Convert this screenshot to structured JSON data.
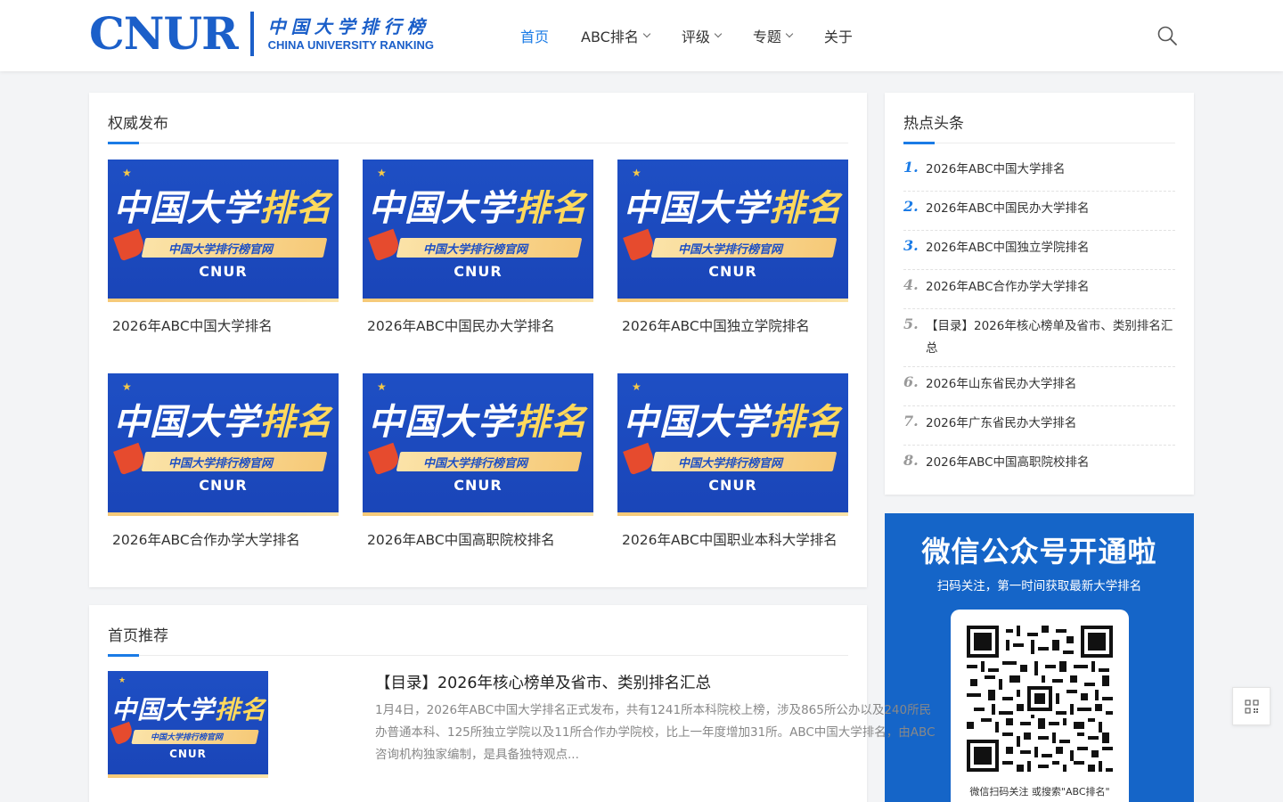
{
  "header": {
    "logo": {
      "text": "CNUR",
      "cn": "中国大学排行榜",
      "en": "CHINA UNIVERSITY RANKING"
    },
    "nav": [
      {
        "label": "首页",
        "active": true,
        "dropdown": false
      },
      {
        "label": "ABC排名",
        "active": false,
        "dropdown": true
      },
      {
        "label": "评级",
        "active": false,
        "dropdown": true
      },
      {
        "label": "专题",
        "active": false,
        "dropdown": true
      },
      {
        "label": "关于",
        "active": false,
        "dropdown": false
      }
    ]
  },
  "banner": {
    "title_a": "中国大学",
    "title_b": "排名",
    "ribbon": "中国大学排行榜官网",
    "brand": "CNUR"
  },
  "authority": {
    "title": "权威发布",
    "items": [
      {
        "caption": "2026年ABC中国大学排名"
      },
      {
        "caption": "2026年ABC中国民办大学排名"
      },
      {
        "caption": "2026年ABC中国独立学院排名"
      },
      {
        "caption": "2026年ABC合作办学大学排名"
      },
      {
        "caption": "2026年ABC中国高职院校排名"
      },
      {
        "caption": "2026年ABC中国职业本科大学排名"
      }
    ]
  },
  "hot": {
    "title": "热点头条",
    "items": [
      {
        "num": "1.",
        "text": "2026年ABC中国大学排名"
      },
      {
        "num": "2.",
        "text": "2026年ABC中国民办大学排名"
      },
      {
        "num": "3.",
        "text": "2026年ABC中国独立学院排名"
      },
      {
        "num": "4.",
        "text": "2026年ABC合作办学大学排名"
      },
      {
        "num": "5.",
        "text": "【目录】2026年核心榜单及省市、类别排名汇总"
      },
      {
        "num": "6.",
        "text": "2026年山东省民办大学排名"
      },
      {
        "num": "7.",
        "text": "2026年广东省民办大学排名"
      },
      {
        "num": "8.",
        "text": "2026年ABC中国高职院校排名"
      }
    ]
  },
  "wechat": {
    "title": "微信公众号开通啦",
    "subtitle": "扫码关注，第一时间获取最新大学排名",
    "caption": "微信扫码关注 或搜索\"ABC排名\""
  },
  "recommend": {
    "title": "首页推荐",
    "items": [
      {
        "title": "【目录】2026年核心榜单及省市、类别排名汇总",
        "excerpt": "1月4日，2026年ABC中国大学排名正式发布，共有1241所本科院校上榜，涉及865所公办以及240所民办普通本科、125所独立学院以及11所合作办学院校，比上一年度增加31所。ABC中国大学排名，由ABC咨询机构独家编制，是具备独特观点..."
      }
    ]
  },
  "colors": {
    "accent": "#1a7be6",
    "brand": "#1b5fc9",
    "banner": "#1e4fc4",
    "wechat_bg": "#1565c8"
  },
  "icons": {
    "search": "search-icon",
    "float": "qrcode-icon"
  }
}
